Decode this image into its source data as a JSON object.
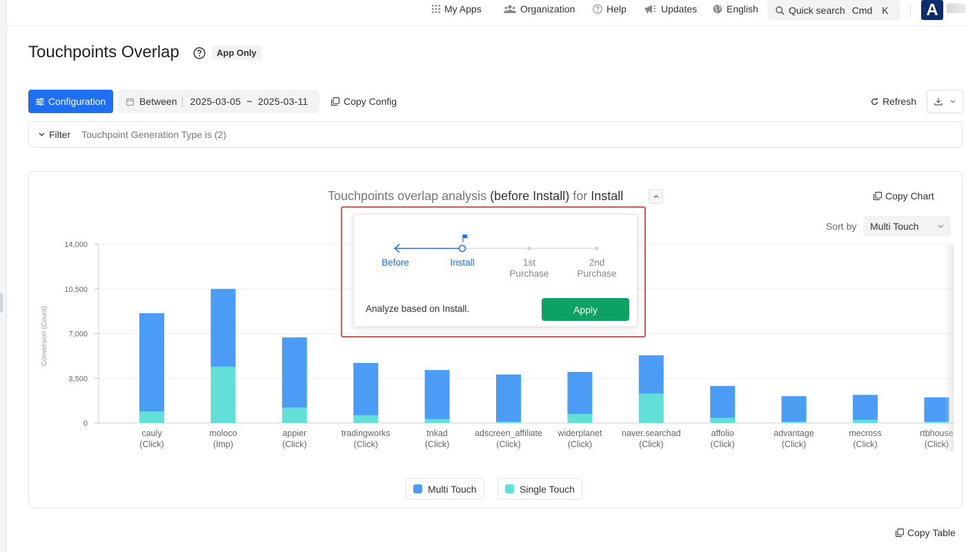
{
  "topbar": {
    "my_apps": "My Apps",
    "organization": "Organization",
    "help": "Help",
    "updates": "Updates",
    "language": "English",
    "quick_search": "Quick search",
    "shortcut_cmd": "Cmd",
    "shortcut_key": "K",
    "logo_letter": "A"
  },
  "header": {
    "title": "Touchpoints Overlap",
    "badge": "App Only"
  },
  "toolbar": {
    "configuration": "Configuration",
    "between": "Between",
    "date_range": "2025-03-05  ~  2025-03-11",
    "copy_config": "Copy Config",
    "refresh": "Refresh"
  },
  "filter": {
    "label": "Filter",
    "text": "Touchpoint Generation Type is (2)"
  },
  "chart_header": {
    "title_prefix": "Touchpoints overlap analysis ",
    "title_bold1": "(before Install)",
    "title_mid": " for ",
    "title_bold2": "Install",
    "copy_chart": "Copy Chart",
    "sort_label": "Sort by",
    "sort_value": "Multi Touch"
  },
  "popover": {
    "steps": [
      {
        "label": "Before",
        "active": true
      },
      {
        "label": "Install",
        "active": true
      },
      {
        "label": "1st\nPurchase",
        "active": false
      },
      {
        "label": "2nd\nPurchase",
        "active": false
      }
    ],
    "analyze_text": "Analyze based on Install.",
    "apply": "Apply"
  },
  "chart_data": {
    "type": "bar",
    "stacked": true,
    "ylabel": "Conversion (Count)",
    "ylim": [
      0,
      14000
    ],
    "yticks": [
      0,
      3500,
      7000,
      10500,
      14000
    ],
    "ytick_labels": [
      "0",
      "3,500",
      "7,000",
      "10,500",
      "14,000"
    ],
    "categories": [
      [
        "cauly",
        "(Click)"
      ],
      [
        "moloco",
        "(Imp)"
      ],
      [
        "appier",
        "(Click)"
      ],
      [
        "tradingworks",
        "(Click)"
      ],
      [
        "tnkad",
        "(Click)"
      ],
      [
        "adscreen_affiliate",
        "(Click)"
      ],
      [
        "widerplanet",
        "(Click)"
      ],
      [
        "naver.searchad",
        "(Click)"
      ],
      [
        "affolio",
        "(Click)"
      ],
      [
        "advantage",
        "(Click)"
      ],
      [
        "mecross",
        "(Click)"
      ],
      [
        "rtbhouse",
        "(Click)"
      ]
    ],
    "series": [
      {
        "name": "Single Touch",
        "color": "#62dfd6",
        "values": [
          900,
          4400,
          1200,
          600,
          300,
          100,
          700,
          2300,
          400,
          100,
          250,
          100
        ]
      },
      {
        "name": "Multi Touch",
        "color": "#4a9cf5",
        "values": [
          7700,
          6100,
          5500,
          4100,
          3850,
          3700,
          3300,
          3000,
          2500,
          2000,
          1950,
          1900
        ]
      }
    ],
    "legend": [
      "Multi Touch",
      "Single Touch"
    ],
    "legend_position": "bottom-center",
    "grid": true
  },
  "footer": {
    "copy_table": "Copy Table"
  }
}
